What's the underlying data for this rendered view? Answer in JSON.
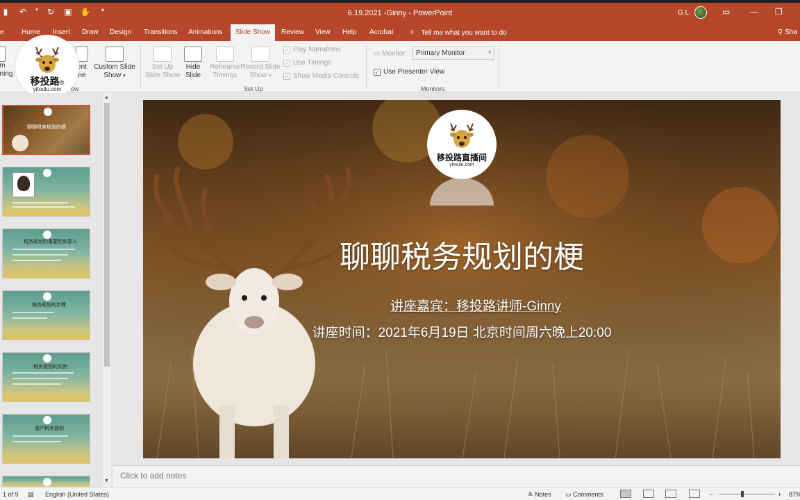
{
  "app": {
    "window_title": "6.19.2021 -Ginny  -  PowerPoint",
    "user_initials": "G L"
  },
  "qat": {
    "save_icon": "save-icon",
    "undo_icon": "undo-icon",
    "redo_icon": "redo-icon"
  },
  "tabs": [
    "Home",
    "Insert",
    "Draw",
    "Design",
    "Transitions",
    "Animations",
    "Slide Show",
    "Review",
    "View",
    "Help",
    "Acrobat"
  ],
  "tabs_partial_left": "e",
  "active_tab": "Slide Show",
  "tell_me": "Tell me what you want to do",
  "share_label": "Sha",
  "ribbon": {
    "partial_btn1_line1": "om",
    "partial_btn1_line2": "nning",
    "partial_btn2_line1": "ent",
    "partial_btn2_line2": "ne",
    "partial_group": "ow",
    "custom_slide_show": {
      "line1": "Custom Slide",
      "line2": "Show"
    },
    "setup_slide_show": {
      "line1": "Set Up",
      "line2": "Slide Show"
    },
    "hide_slide": {
      "line1": "Hide",
      "line2": "Slide"
    },
    "rehearse_timings": {
      "line1": "Rehearse",
      "line2": "Timings"
    },
    "record_slide_show": {
      "line1": "Record Slide",
      "line2": "Show"
    },
    "play_narrations": "Play Narrations",
    "use_timings": "Use Timings",
    "show_media_controls": "Show Media Controls",
    "setup_group": "Set Up",
    "monitor_label": "Monitor:",
    "monitor_value": "Primary Monitor",
    "use_presenter_view": "Use Presenter View",
    "monitors_group": "Monitors"
  },
  "logo": {
    "brand": "移投路",
    "site": "yitoulu.com",
    "registered": "®",
    "slide_brand": "移投路直播间"
  },
  "slide": {
    "title": "聊聊税务规划的梗",
    "speaker": "讲座嘉宾：移投路讲师-Ginny",
    "time": "讲座时间：2021年6月19日 北京时间周六晚上20:00"
  },
  "thumbnails": [
    {
      "title": "聊聊税务规划的梗"
    },
    {
      "title": ""
    },
    {
      "title": "税务规划的重要性和意义"
    },
    {
      "title": "税务规划的步骤"
    },
    {
      "title": "税务规划的实例"
    },
    {
      "title": "遗产税务规划"
    }
  ],
  "notes_placeholder": "Click to add notes",
  "status": {
    "slide_counter": "1 of 9",
    "language": "English (United States)",
    "notes": "Notes",
    "comments": "Comments",
    "zoom": "87%"
  },
  "colors": {
    "accent": "#b7472a",
    "ribbon_bg": "#f3f3f3"
  }
}
